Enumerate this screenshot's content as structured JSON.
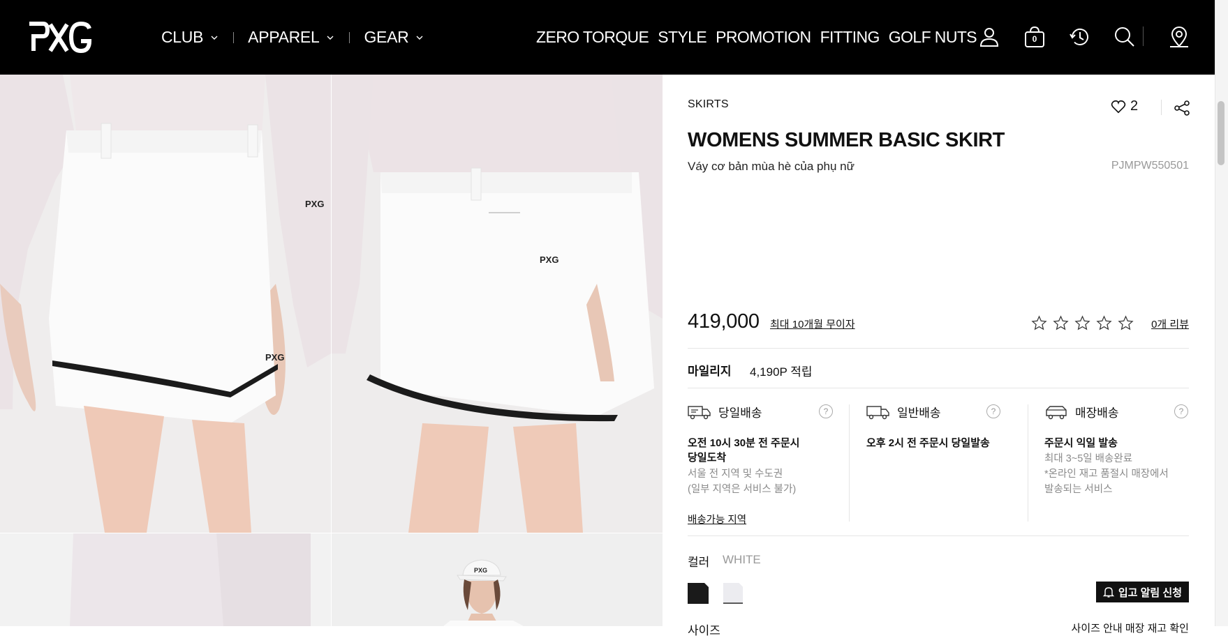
{
  "header": {
    "logo": "PXG",
    "nav_left": [
      {
        "label": "CLUB"
      },
      {
        "label": "APPAREL"
      },
      {
        "label": "GEAR"
      }
    ],
    "nav_right": [
      {
        "label": "ZERO TORQUE"
      },
      {
        "label": "STYLE"
      },
      {
        "label": "PROMOTION"
      },
      {
        "label": "FITTING"
      },
      {
        "label": "GOLF NUTS"
      }
    ],
    "cart_count": "0",
    "icons": [
      "user-icon",
      "shopping-bag-icon",
      "history-icon",
      "search-icon",
      "store-location-icon"
    ]
  },
  "product": {
    "category": "SKIRTS",
    "wishlist_count": "2",
    "title": "WOMENS SUMMER BASIC SKIRT",
    "subtitle": "Váy cơ bản mùa hè của phụ nữ",
    "sku": "PJMPW550501",
    "price": "419,000",
    "installment": "최대 10개월 무이자",
    "rating": 0,
    "reviews": "0개 리뷰",
    "mileage_label": "마일리지",
    "mileage_value": "4,190P 적립"
  },
  "shipping": [
    {
      "title": "당일배송",
      "bold_lines": [
        "오전 10시 30분 전 주문시",
        "당일도착"
      ],
      "gray_lines": [
        "서울 전 지역 및 수도권",
        "(일부 지역은 서비스 불가)"
      ],
      "link": "배송가능 지역"
    },
    {
      "title": "일반배송",
      "bold_lines": [
        "오후 2시 전 주문시 당일발송"
      ],
      "gray_lines": []
    },
    {
      "title": "매장배송",
      "bold_lines": [
        "주문시 익일 발송"
      ],
      "gray_lines": [
        "최대 3~5일 배송완료",
        "*온라인 재고 품절시 매장에서",
        "발송되는 서비스"
      ]
    }
  ],
  "color": {
    "label": "컬러",
    "selected": "WHITE",
    "swatches": [
      {
        "name": "BLACK",
        "hex": "#1a1a1a"
      },
      {
        "name": "WHITE",
        "hex": "#ececf0"
      }
    ]
  },
  "restock_button": "입고 알림 신청",
  "cutoff_left": "사이즈",
  "cutoff_right": "사이즈 안내   매장 재고 확인"
}
